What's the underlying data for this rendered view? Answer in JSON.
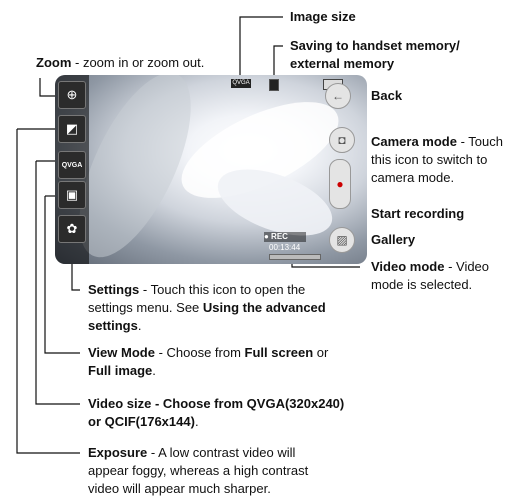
{
  "screen": {
    "top_indicators": {
      "size_badge": "QVGA"
    },
    "rec_label": "● REC",
    "timer": "00:13:44",
    "left_buttons": [
      {
        "name": "zoom-icon",
        "glyph": "⊕"
      },
      {
        "name": "exposure-icon",
        "glyph": "◩"
      },
      {
        "name": "video-size-icon",
        "glyph": "QVGA"
      },
      {
        "name": "view-mode-icon",
        "glyph": "▣"
      },
      {
        "name": "settings-icon",
        "glyph": "✿"
      }
    ],
    "right_buttons": [
      {
        "name": "back-icon",
        "glyph": "←"
      },
      {
        "name": "camera-icon",
        "glyph": "◘"
      },
      {
        "name": "record-icon",
        "glyph": "●"
      },
      {
        "name": "gallery-icon",
        "glyph": "▨"
      }
    ]
  },
  "labels": {
    "image_size": {
      "bold": "Image size"
    },
    "saving": {
      "line1": "Saving to handset memory/",
      "line2": "external memory"
    },
    "zoom": {
      "bold": "Zoom",
      "rest": " - zoom in or zoom out."
    },
    "back": {
      "bold": "Back"
    },
    "camera_mode": {
      "bold": "Camera mode",
      "rest": " - Touch",
      "line2": "this icon to switch to",
      "line3": "camera mode."
    },
    "start_recording": {
      "bold": "Start recording"
    },
    "gallery": {
      "bold": "Gallery"
    },
    "video_mode": {
      "bold": "Video mode",
      "rest": " - Video",
      "line2": "mode is selected."
    },
    "settings": {
      "bold": "Settings",
      "rest": " - Touch this icon to open the",
      "line2": "settings menu. See ",
      "line2_bold": "Using the advanced",
      "line3_bold": "settings",
      "line3_rest": "."
    },
    "view_mode": {
      "bold": "View Mode",
      "rest": " - Choose from ",
      "bold2": "Full screen",
      "rest2": " or",
      "line2_bold": "Full image",
      "line2_rest": "."
    },
    "video_size": {
      "line1": "Video size - Choose from QVGA(320x240)",
      "line2_bold": "or QCIF(176x144)",
      "line2_rest": "."
    },
    "exposure": {
      "bold": "Exposure",
      "rest": " - A low contrast video will",
      "line2": "appear foggy, whereas a high contrast",
      "line3": "video will appear much sharper."
    }
  }
}
